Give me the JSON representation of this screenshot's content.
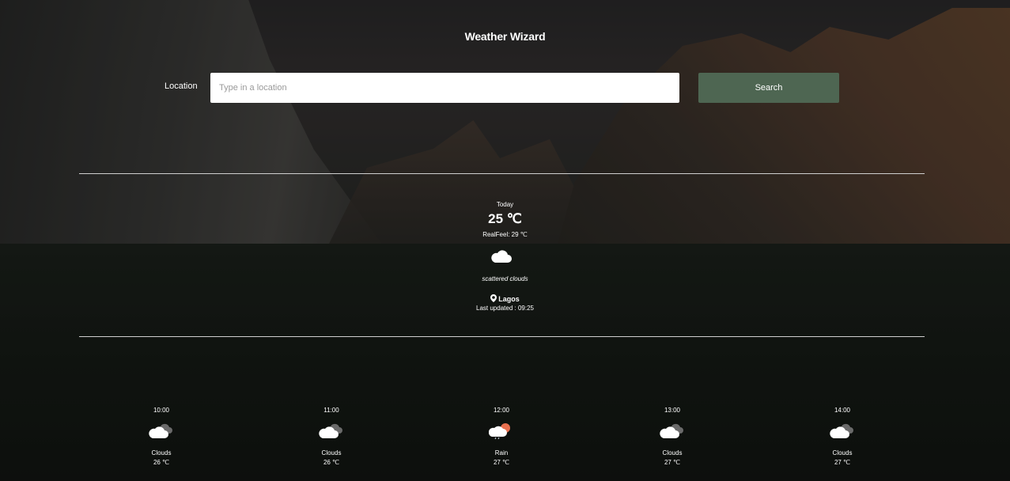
{
  "app": {
    "title": "Weather Wizard"
  },
  "search": {
    "label": "Location",
    "placeholder": "Type in a location",
    "value": "",
    "button_label": "Search"
  },
  "current": {
    "day_label": "Today",
    "temperature": "25 ℃",
    "realfeel": "RealFeel: 29 ℃",
    "icon": "cloud-icon",
    "description": "scattered clouds",
    "city": "Lagos",
    "last_updated": "Last updated : 09:25"
  },
  "hourly": [
    {
      "time": "10:00",
      "icon": "clouds-icon",
      "condition": "Clouds",
      "temp": "26 ℃"
    },
    {
      "time": "11:00",
      "icon": "clouds-icon",
      "condition": "Clouds",
      "temp": "26 ℃"
    },
    {
      "time": "12:00",
      "icon": "rain-icon",
      "condition": "Rain",
      "temp": "27 ℃"
    },
    {
      "time": "13:00",
      "icon": "clouds-icon",
      "condition": "Clouds",
      "temp": "27 ℃"
    },
    {
      "time": "14:00",
      "icon": "clouds-icon",
      "condition": "Clouds",
      "temp": "27 ℃"
    }
  ],
  "colors": {
    "search_button": "#4e6652",
    "divider": "#cfcfcf",
    "text": "#ffffff"
  }
}
